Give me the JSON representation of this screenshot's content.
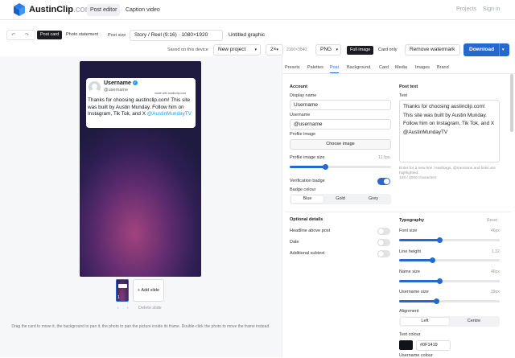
{
  "header": {
    "brand_name": "AustinClip",
    "brand_domain": ".com",
    "nav": [
      "Post editor",
      "Caption video"
    ],
    "projects": "Projects",
    "sign_in": "Sign in"
  },
  "toolbar": {
    "mode_post_card": "Post card",
    "mode_photo_statement": "Photo statement",
    "post_size_label": "Post size",
    "post_size_value": "Story / Reel (9:16) · 1080×1920",
    "project_title": "Untitled graphic",
    "saved_status": "Saved on this device",
    "new_project": "New project",
    "scale": "2×",
    "dimensions": "2160×3840",
    "format": "PNG",
    "full_image": "Full image",
    "card_only": "Card only",
    "remove_watermark": "Remove watermark",
    "download": "Download"
  },
  "preview": {
    "display_name": "Username",
    "handle": "@username",
    "watermark_text": "made with austinclip.com",
    "post_text": "Thanks for choosing austinclip.com! This site was built by Austin Munday. Follow him on Instagram, Tik Tok, and X",
    "post_link": "@AustinMundayTV",
    "slide_number": "1",
    "add_slide": "+ Add slide",
    "delete_slide": "Delete slide",
    "help_text": "Drag the card to move it, the background to pan it, the photo to pan the picture inside its frame. Double-click the photo to move the frame instead."
  },
  "tabs": [
    "Presets",
    "Palettes",
    "Post",
    "Background",
    "Card",
    "Media",
    "Images",
    "Brand"
  ],
  "active_tab": "Post",
  "account": {
    "heading": "Account",
    "display_name_label": "Display name",
    "display_name_value": "Username",
    "username_label": "Username",
    "username_value": "@username",
    "profile_image_label": "Profile image",
    "choose_image": "Choose image",
    "profile_image_size_label": "Profile image size",
    "profile_image_size_value": "117px",
    "profile_image_size_level": 0.35,
    "verification_badge_label": "Verification badge",
    "verification_badge_on": true,
    "badge_colour_label": "Badge colour",
    "badge_colours": [
      "Blue",
      "Gold",
      "Grey"
    ],
    "badge_colour_selected": "Blue"
  },
  "post_text": {
    "heading": "Post text",
    "text_label": "Text",
    "text_value": "Thanks for choosing austinclip.com! This site was built by Austin Munday. Follow him on Instagram, Tik Tok, and X @AustinMundayTV",
    "hint": "Enter for a new line. Hashtags, @mentions and links are highlighted.",
    "char_count": "128 / 4000 characters"
  },
  "optional_details": {
    "heading": "Optional details",
    "headline": "Headline above post",
    "date": "Date",
    "subtext": "Additional subtext"
  },
  "typography": {
    "heading": "Typography",
    "reset": "Reset",
    "font_size_label": "Font size",
    "font_size_value": "46px",
    "font_size_level": 0.4,
    "line_height_label": "Line height",
    "line_height_value": "1.32",
    "line_height_level": 0.33,
    "name_size_label": "Name size",
    "name_size_value": "46px",
    "name_size_level": 0.4,
    "username_size_label": "Username size",
    "username_size_value": "39px",
    "username_size_level": 0.37,
    "alignment_label": "Alignment",
    "align_left": "Left",
    "align_centre": "Centre",
    "text_colour_label": "Text colour",
    "text_colour_value": "#0F1419",
    "username_colour_label": "Username colour"
  },
  "colors": {
    "accent": "#2468d0",
    "text_colour": "#0F1419",
    "link": "#1d9bf0"
  }
}
